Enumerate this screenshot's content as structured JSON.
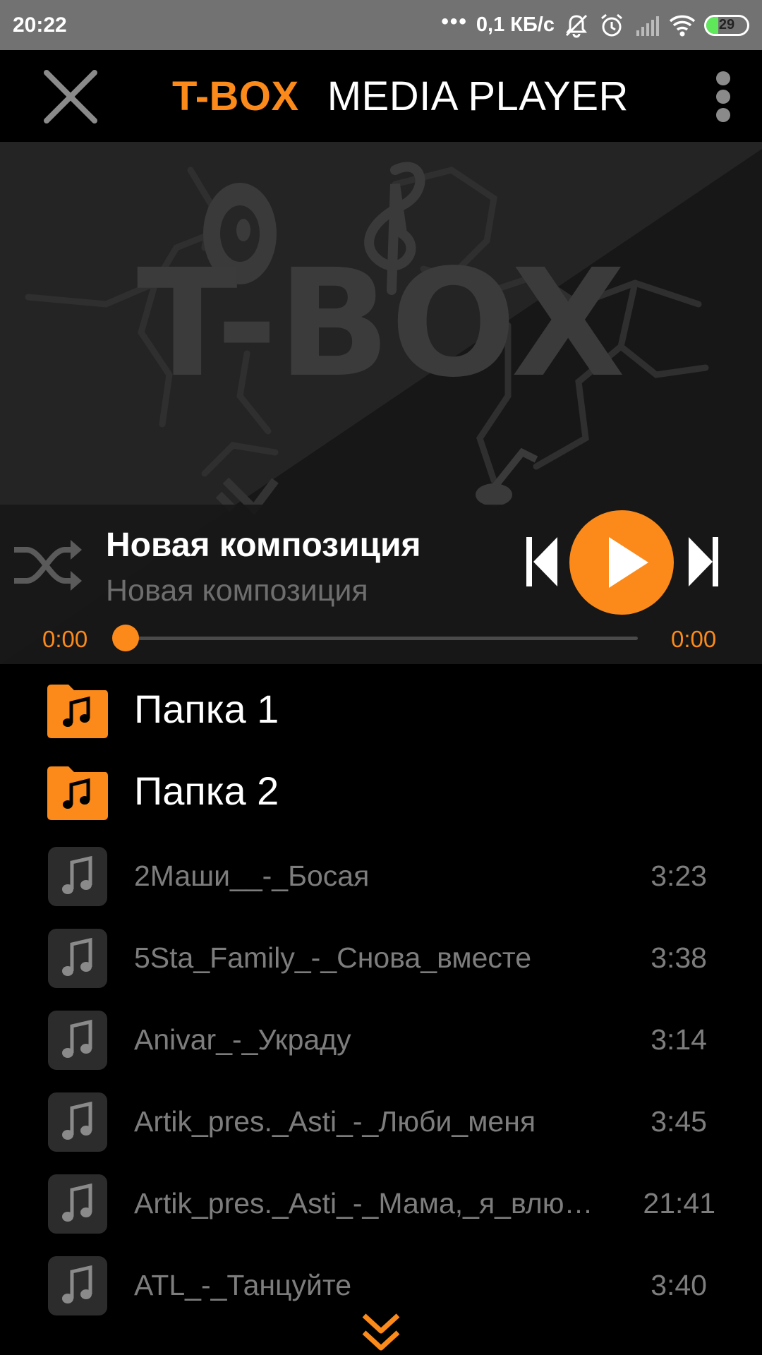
{
  "status_bar": {
    "time": "20:22",
    "dots": "•••",
    "net_speed": "0,1 КБ/с",
    "battery_level": "29",
    "icons": [
      "mute-bell-icon",
      "alarm-icon",
      "signal-icon",
      "wifi-icon",
      "battery-icon"
    ]
  },
  "header": {
    "title_brand": "T-BOX",
    "title_rest": "MEDIA PLAYER",
    "close_icon": "close-icon",
    "menu_icon": "more-vert-icon"
  },
  "artwork": {
    "logo_text": "T-BOX"
  },
  "player": {
    "track_title": "Новая композиция",
    "track_artist": "Новая композиция",
    "elapsed": "0:00",
    "total": "0:00",
    "progress": 0,
    "icons": [
      "shuffle-icon",
      "skip-previous-icon",
      "play-icon",
      "skip-next-icon"
    ]
  },
  "folders": [
    {
      "label": "Папка 1"
    },
    {
      "label": "Папка 2"
    }
  ],
  "tracks": [
    {
      "name": "2Маши__-_Босая",
      "duration": "3:23"
    },
    {
      "name": "5Sta_Family_-_Снова_вместе",
      "duration": "3:38"
    },
    {
      "name": "Anivar_-_Украду",
      "duration": "3:14"
    },
    {
      "name": "Artik_pres._Asti_-_Люби_меня",
      "duration": "3:45"
    },
    {
      "name": "Artik_pres._Asti_-_Мама,_я_влю…",
      "duration": "21:41"
    },
    {
      "name": "ATL_-_Танцуйте",
      "duration": "3:40"
    }
  ],
  "colors": {
    "accent": "#fb8a1a",
    "background": "#000000",
    "status_bar": "#727272",
    "muted_text": "#7d7d7d"
  }
}
